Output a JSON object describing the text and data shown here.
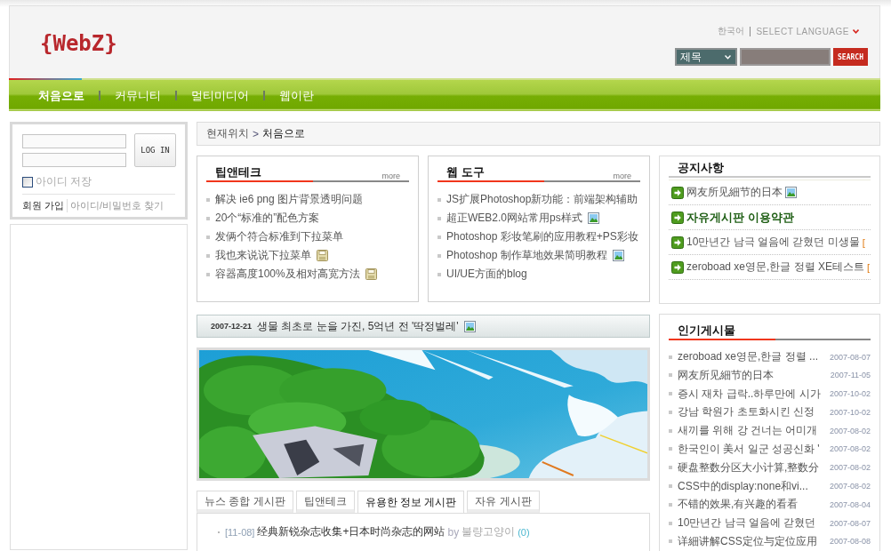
{
  "header": {
    "logo": "{WebZ}",
    "language": {
      "current": "한국어",
      "label": "SELECT LANGUAGE"
    },
    "search": {
      "scope": "제목",
      "button": "SEARCH"
    }
  },
  "nav": [
    {
      "label": "처음으로",
      "selected": true
    },
    {
      "label": "커뮤니티",
      "selected": false
    },
    {
      "label": "멀티미디어",
      "selected": false
    },
    {
      "label": "웹이란",
      "selected": false
    }
  ],
  "login": {
    "button": "LOG IN",
    "remember": {
      "label": "아이디 저장",
      "checked": false
    },
    "links": [
      "회원 가입",
      "아이디/비밀번호 찾기"
    ]
  },
  "breadcrumb": {
    "label": "현재위치",
    "separator": ">",
    "current": "처음으로"
  },
  "boxes": [
    {
      "title": "팁앤테크",
      "more": "more",
      "items": [
        {
          "text": "解决 ie6 png 图片背景透明问题",
          "kind": "plain"
        },
        {
          "text": "20个“标准的”配色方案",
          "kind": "plain"
        },
        {
          "text": "发俩个符合标准到下拉菜单",
          "kind": "plain"
        },
        {
          "text": "我也来说说下拉菜单",
          "kind": "file"
        },
        {
          "text": "容器高度100%及相对高宽方法",
          "kind": "file"
        }
      ]
    },
    {
      "title": "웹 도구",
      "more": "more",
      "items": [
        {
          "text": "JS扩展Photoshop新功能：前端架构辅助",
          "kind": "plain"
        },
        {
          "text": "超正WEB2.0网站常用ps样式",
          "kind": "image"
        },
        {
          "text": "Photoshop 彩妆笔刷的应用教程+PS彩妆",
          "kind": "plain"
        },
        {
          "text": "Photoshop 制作草地效果简明教程",
          "kind": "image"
        },
        {
          "text": "UI/UE方面的blog",
          "kind": "plain"
        }
      ]
    }
  ],
  "headline": {
    "date": "2007-12-21",
    "title": "생물 최초로 눈을 가진, 5억년 전 '딱정벌레'",
    "kind": "image"
  },
  "tabs": [
    {
      "label": "뉴스 종합 게시판",
      "selected": false
    },
    {
      "label": "팁앤테크",
      "selected": false
    },
    {
      "label": "유용한 정보 게시판",
      "selected": true
    },
    {
      "label": "자유 게시판",
      "selected": false
    }
  ],
  "posts": [
    {
      "date": "[11-08]",
      "title": "经典新锐杂志收集+日本时尚杂志的网站",
      "by": "by",
      "author": "불량고양이",
      "count": "(0)"
    }
  ],
  "notices": {
    "title": "공지사항",
    "items": [
      {
        "text": "网友所见細节的日本",
        "kind": "image",
        "emphasized": false
      },
      {
        "text": "자유게시판 이용약관",
        "kind": "plain",
        "emphasized": true
      },
      {
        "text": "10만년간 남극 얼음에 갇혔던 미생물",
        "kind": "plain",
        "comments": "[",
        "emphasized": false
      },
      {
        "text": "zeroboad xe영문,한글 정렬 XE테스트",
        "kind": "plain",
        "comments": "[",
        "emphasized": false
      }
    ]
  },
  "popular": {
    "title": "인기게시물",
    "items": [
      {
        "text": "zeroboad xe영문,한글 정렬 ...",
        "date": "2007-08-07"
      },
      {
        "text": "网友所见細节的日本",
        "date": "2007-11-05"
      },
      {
        "text": "증시 재차 급락..하루만에 시가",
        "date": "2007-10-02"
      },
      {
        "text": "강남 학원가 초토화시킨 신정",
        "date": "2007-10-02"
      },
      {
        "text": "새끼를 위해 강 건너는 어미개",
        "date": "2007-08-02"
      },
      {
        "text": "한국인이 美서 일군 성공신화 '",
        "date": "2007-08-02"
      },
      {
        "text": "硬盘整数分区大小计算,整数分",
        "date": "2007-08-02"
      },
      {
        "text": "CSS中的display:none和vi...",
        "date": "2007-08-02"
      },
      {
        "text": "不错的效果,有兴趣的看看",
        "date": "2007-08-04"
      },
      {
        "text": "10만년간 남극 얼음에 갇혔던",
        "date": "2007-08-07"
      },
      {
        "text": "详細讲解CSS定位与定位应用",
        "date": "2007-08-08"
      }
    ]
  }
}
